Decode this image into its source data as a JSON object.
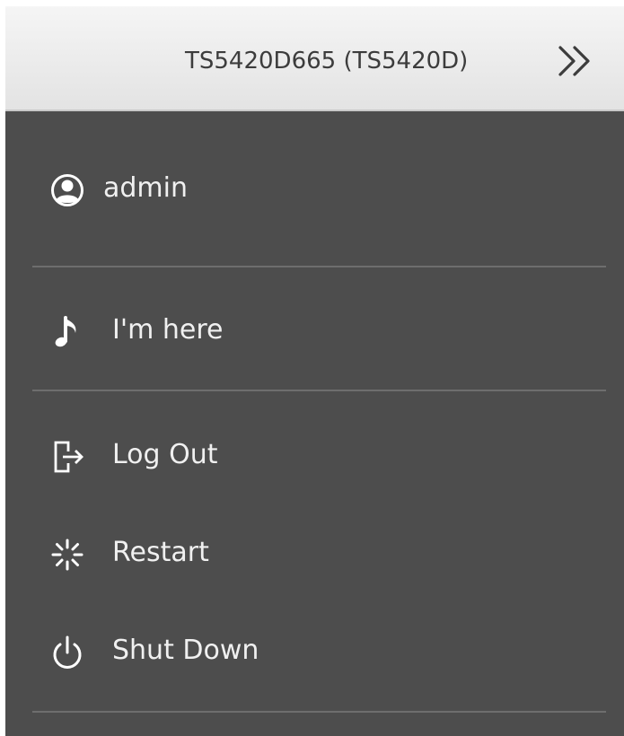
{
  "header": {
    "title": "TS5420D665 (TS5420D)",
    "collapse_icon": "double-chevron-right-icon"
  },
  "menu": {
    "user": {
      "label": "admin",
      "icon": "user-circle-icon"
    },
    "items": [
      {
        "label": "I'm here",
        "icon": "music-note-icon"
      },
      {
        "label": "Log Out",
        "icon": "logout-icon"
      },
      {
        "label": "Restart",
        "icon": "restart-icon"
      },
      {
        "label": "Shut Down",
        "icon": "power-icon"
      }
    ]
  },
  "colors": {
    "panel_background": "#4d4d4d",
    "header_background": "#ececec",
    "text_light": "#f0f0f0",
    "header_text": "#3c3c3c",
    "divider": "#6e6e6e"
  }
}
